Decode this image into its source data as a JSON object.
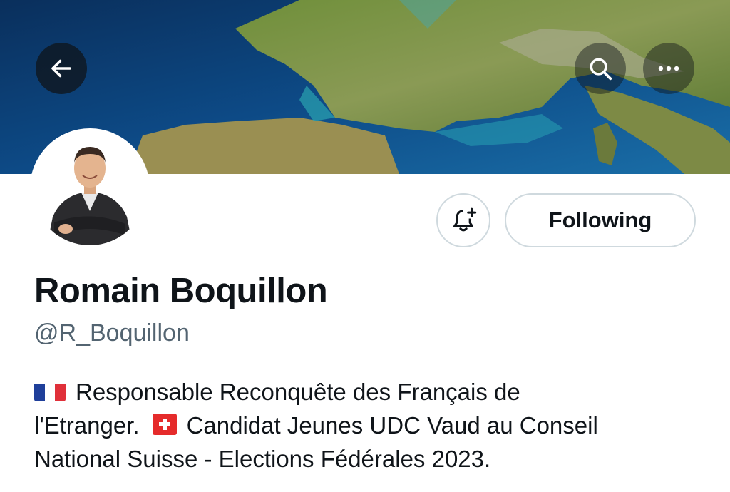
{
  "header": {
    "banner_image": "europe-relief-map",
    "back_icon": "arrow-left-icon",
    "search_icon": "search-icon",
    "more_icon": "more-horizontal-icon"
  },
  "profile": {
    "avatar": "profile-photo",
    "display_name": "Romain Boquillon",
    "handle": "@R_Boquillon",
    "notify_icon": "bell-plus-icon",
    "follow_button_label": "Following",
    "bio": {
      "line1": "Responsable Reconquête des Français de",
      "line2_a": "l'Etranger.",
      "line2_b": "Candidat Jeunes UDC Vaud au Conseil",
      "line3": "National Suisse - Elections Fédérales 2023."
    }
  },
  "colors": {
    "text_primary": "#0f1419",
    "text_secondary": "#536471",
    "border": "#cfd9de"
  }
}
